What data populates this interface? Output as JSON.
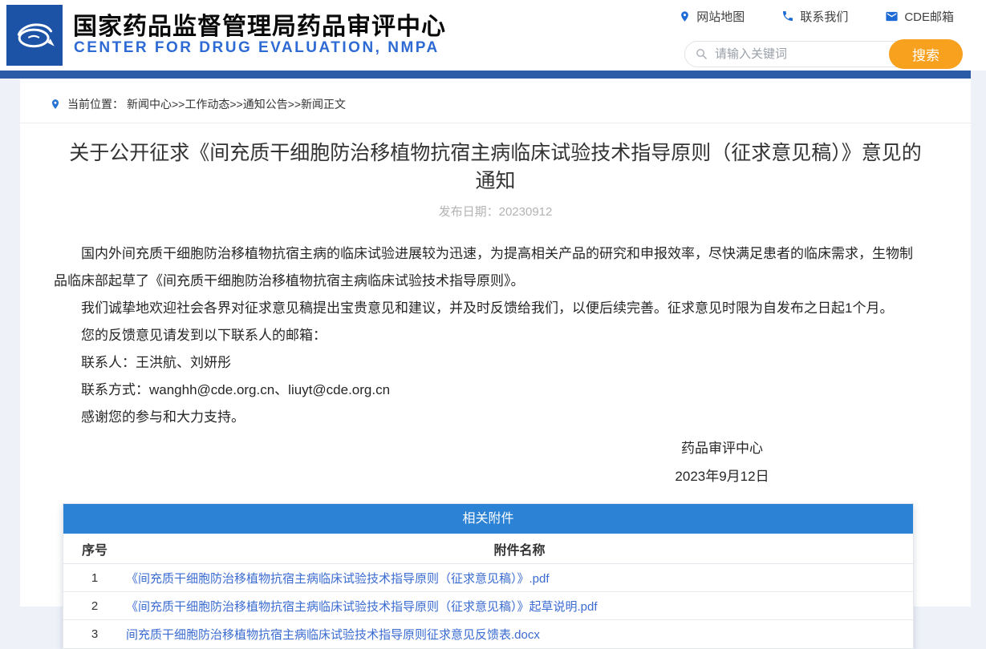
{
  "header": {
    "title": "国家药品监督管理局药品审评中心",
    "subtitle": "CENTER FOR DRUG EVALUATION, NMPA",
    "quick_links": [
      {
        "icon": "map-pin-icon",
        "label": "网站地图"
      },
      {
        "icon": "phone-icon",
        "label": "联系我们"
      },
      {
        "icon": "mail-icon",
        "label": "CDE邮箱"
      }
    ],
    "search": {
      "placeholder": "请输入关键词",
      "button_label": "搜索"
    }
  },
  "breadcrumb": {
    "label": "当前位置：",
    "path": "新闻中心>>工作动态>>通知公告>>新闻正文"
  },
  "article": {
    "title": "关于公开征求《间充质干细胞防治移植物抗宿主病临床试验技术指导原则（征求意见稿）》意见的通知",
    "publish_date": "发布日期：20230912",
    "paragraphs": [
      "国内外间充质干细胞防治移植物抗宿主病的临床试验进展较为迅速，为提高相关产品的研究和申报效率，尽快满足患者的临床需求，生物制品临床部起草了《间充质干细胞防治移植物抗宿主病临床试验技术指导原则》。",
      "我们诚挚地欢迎社会各界对征求意见稿提出宝贵意见和建议，并及时反馈给我们，以便后续完善。征求意见时限为自发布之日起1个月。",
      "您的反馈意见请发到以下联系人的邮箱：",
      "联系人：王洪航、刘妍彤",
      "联系方式：wanghh@cde.org.cn、liuyt@cde.org.cn",
      "感谢您的参与和大力支持。"
    ],
    "signature": {
      "org": "药品审评中心",
      "date": "2023年9月12日"
    }
  },
  "attachments": {
    "title": "相关附件",
    "columns": {
      "no": "序号",
      "name": "附件名称"
    },
    "rows": [
      {
        "no": "1",
        "name": "《间充质干细胞防治移植物抗宿主病临床试验技术指导原则（征求意见稿）》.pdf"
      },
      {
        "no": "2",
        "name": "《间充质干细胞防治移植物抗宿主病临床试验技术指导原则（征求意见稿）》起草说明.pdf"
      },
      {
        "no": "3",
        "name": "间充质干细胞防治移植物抗宿主病临床试验技术指导原则征求意见反馈表.docx"
      }
    ]
  },
  "colors": {
    "nav_bar": "#2b5aa7",
    "table_header": "#2c82d4",
    "search_button": "#f8a11f",
    "link_blue": "#3a6bd0",
    "subtitle_blue": "#2e6ad3",
    "logo_blue": "#1c53a6",
    "page_background": "#eef1f8"
  }
}
